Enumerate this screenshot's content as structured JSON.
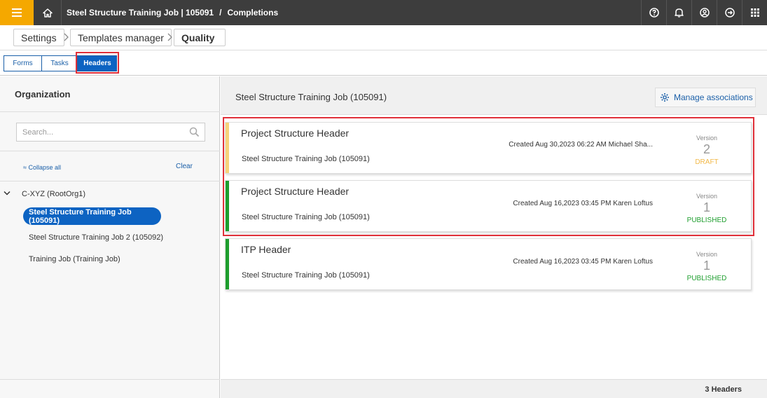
{
  "topbar": {
    "job_title": "Steel Structure Training Job | 105091",
    "separator": "/",
    "section": "Completions",
    "icons": [
      "menu-icon",
      "home-icon",
      "help-icon",
      "bell-icon",
      "user-icon",
      "logout-icon",
      "apps-grid-icon"
    ],
    "accent_color": "#f5a800"
  },
  "breadcrumb": {
    "settings": "Settings",
    "templates_manager": "Templates manager",
    "quality": "Quality"
  },
  "tabs": [
    {
      "label": "Forms",
      "active": false
    },
    {
      "label": "Tasks",
      "active": false
    },
    {
      "label": "Headers",
      "active": true
    }
  ],
  "left": {
    "title": "Organization",
    "search_placeholder": "Search...",
    "collapse_all": "Collapse all",
    "collapse_glyph": "≈",
    "clear": "Clear",
    "tree": {
      "root": "C-XYZ (RootOrg1)",
      "children": [
        {
          "label": "Steel Structure Training Job (105091)",
          "selected": true
        },
        {
          "label": "Steel Structure Training Job 2 (105092)",
          "selected": false
        },
        {
          "label": "Training Job (Training Job)",
          "selected": false
        }
      ]
    }
  },
  "right": {
    "title": "Steel Structure Training Job (105091)",
    "manage_label": "Manage associations",
    "footer_count": "3 Headers",
    "cards": [
      {
        "title": "Project Structure Header",
        "subtitle": "Steel Structure Training Job (105091)",
        "created": "Created Aug 30,2023 06:22 AM Michael Sha...",
        "version_label": "Version",
        "version": "2",
        "status": "DRAFT",
        "status_color": "#f2b94a",
        "bar_color": "#f7d27a"
      },
      {
        "title": "Project Structure Header",
        "subtitle": "Steel Structure Training Job (105091)",
        "created": "Created Aug 16,2023 03:45 PM Karen Loftus",
        "version_label": "Version",
        "version": "1",
        "status": "PUBLISHED",
        "status_color": "#1e9e2e",
        "bar_color": "#1e9e2e"
      },
      {
        "title": "ITP Header",
        "subtitle": "Steel Structure Training Job (105091)",
        "created": "Created Aug 16,2023 03:45 PM Karen Loftus",
        "version_label": "Version",
        "version": "1",
        "status": "PUBLISHED",
        "status_color": "#1e9e2e",
        "bar_color": "#1e9e2e"
      }
    ]
  },
  "highlight_color": "#e0303a"
}
